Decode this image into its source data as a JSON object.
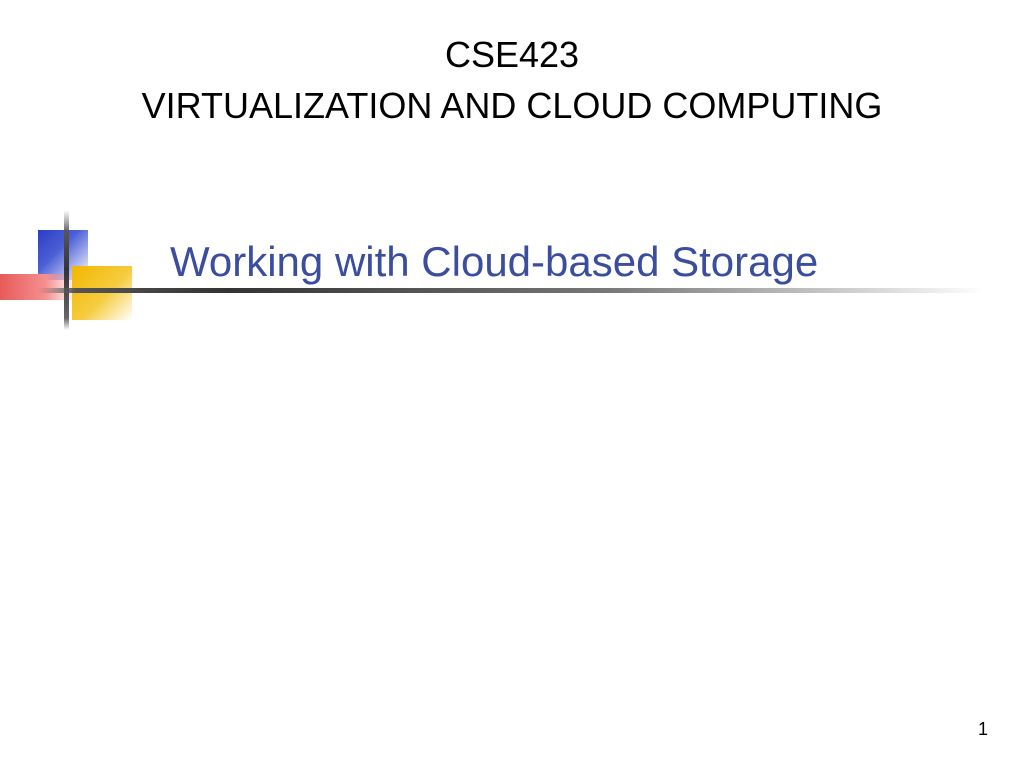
{
  "header": {
    "course_code": "CSE423",
    "course_name": "VIRTUALIZATION AND CLOUD COMPUTING"
  },
  "slide": {
    "title": "Working with Cloud-based Storage"
  },
  "footer": {
    "page_number": "1"
  }
}
